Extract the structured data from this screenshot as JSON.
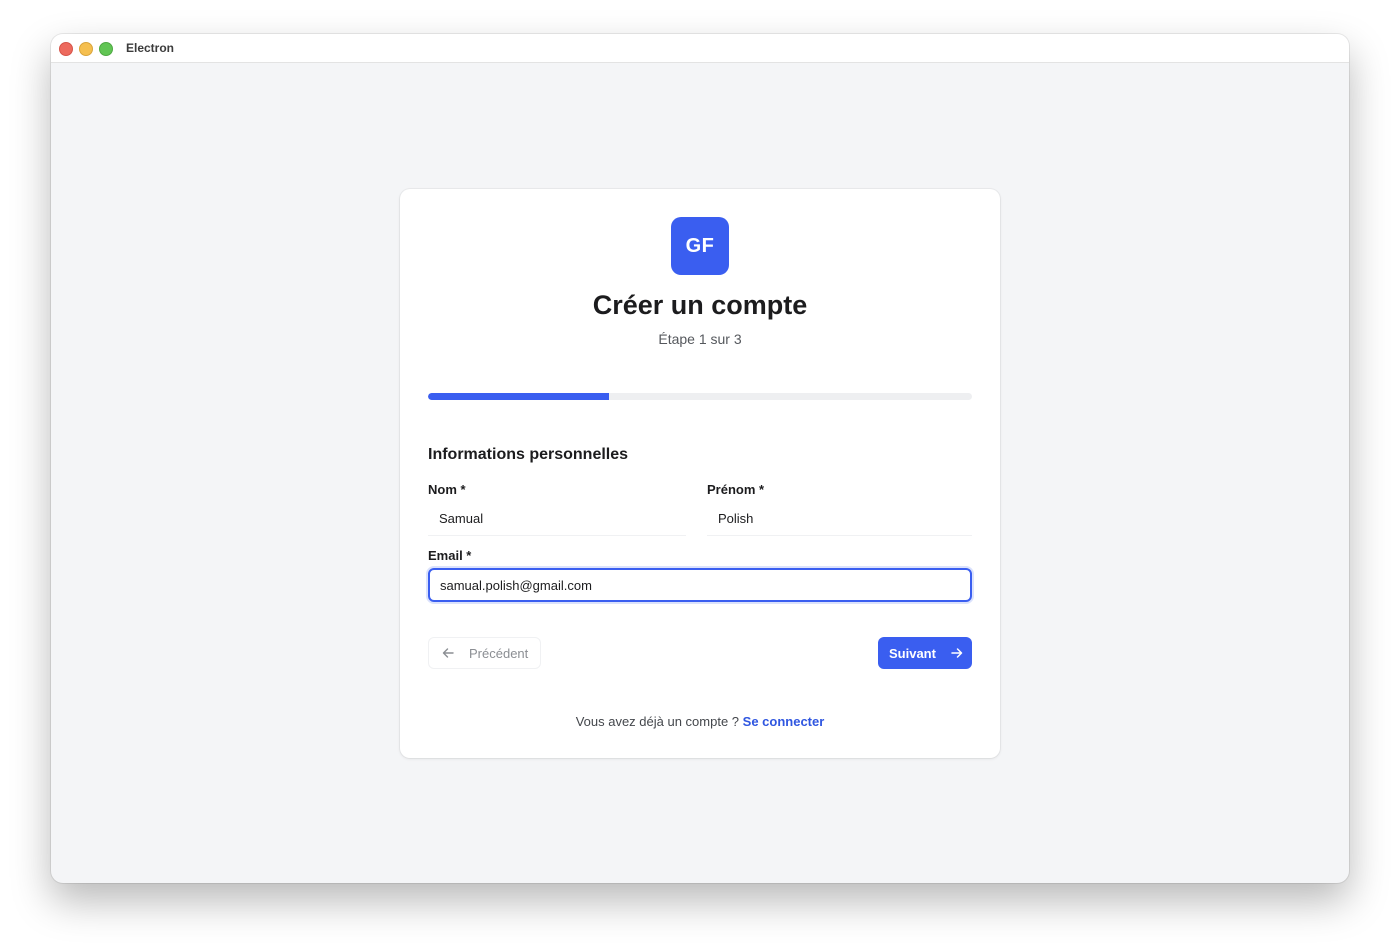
{
  "window": {
    "title": "Electron",
    "controls": [
      "close",
      "minimize",
      "maximize"
    ]
  },
  "logo": {
    "text": "GF",
    "color": "#3a5ef0"
  },
  "header": {
    "title": "Créer un compte",
    "step": "Étape 1 sur 3"
  },
  "progress": {
    "current_step": 1,
    "total_steps": 3,
    "fraction": 0.333,
    "color": "#3a5ef0"
  },
  "form": {
    "section_title": "Informations personnelles",
    "nom": {
      "label": "Nom *",
      "value": "Samual"
    },
    "prenom": {
      "label": "Prénom *",
      "value": "Polish"
    },
    "email": {
      "label": "Email *",
      "value": "samual.polish@gmail.com",
      "focused": true
    }
  },
  "buttons": {
    "previous": {
      "label": "Précédent",
      "icon": "arrow-left-icon",
      "disabled": true
    },
    "next": {
      "label": "Suivant",
      "icon": "arrow-right-icon"
    }
  },
  "footer": {
    "text": "Vous avez déjà un compte ?",
    "link": "Se connecter",
    "link_color": "#2f56e0"
  }
}
